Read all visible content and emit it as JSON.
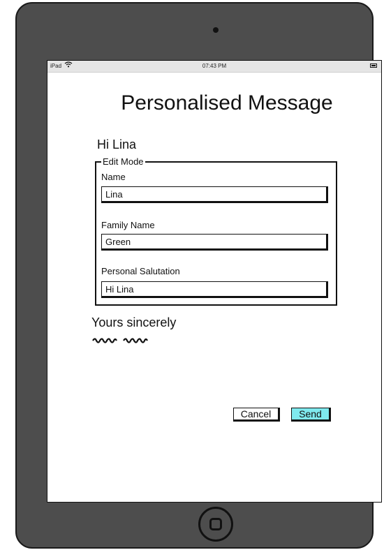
{
  "statusbar": {
    "carrier": "iPad",
    "time": "07:43 PM",
    "wifi_icon": "wifi-icon",
    "battery_icon": "battery-icon"
  },
  "page": {
    "title": "Personalised Message",
    "greeting": "Hi Lina"
  },
  "edit_mode": {
    "legend": "Edit Mode",
    "name_label": "Name",
    "name_value": "Lina",
    "family_label": "Family Name",
    "family_value": "Green",
    "salutation_label": "Personal Salutation",
    "salutation_value": "Hi Lina"
  },
  "closing": {
    "text": "Yours sincerely"
  },
  "actions": {
    "cancel_label": "Cancel",
    "send_label": "Send",
    "send_color": "#7fe9ee"
  }
}
